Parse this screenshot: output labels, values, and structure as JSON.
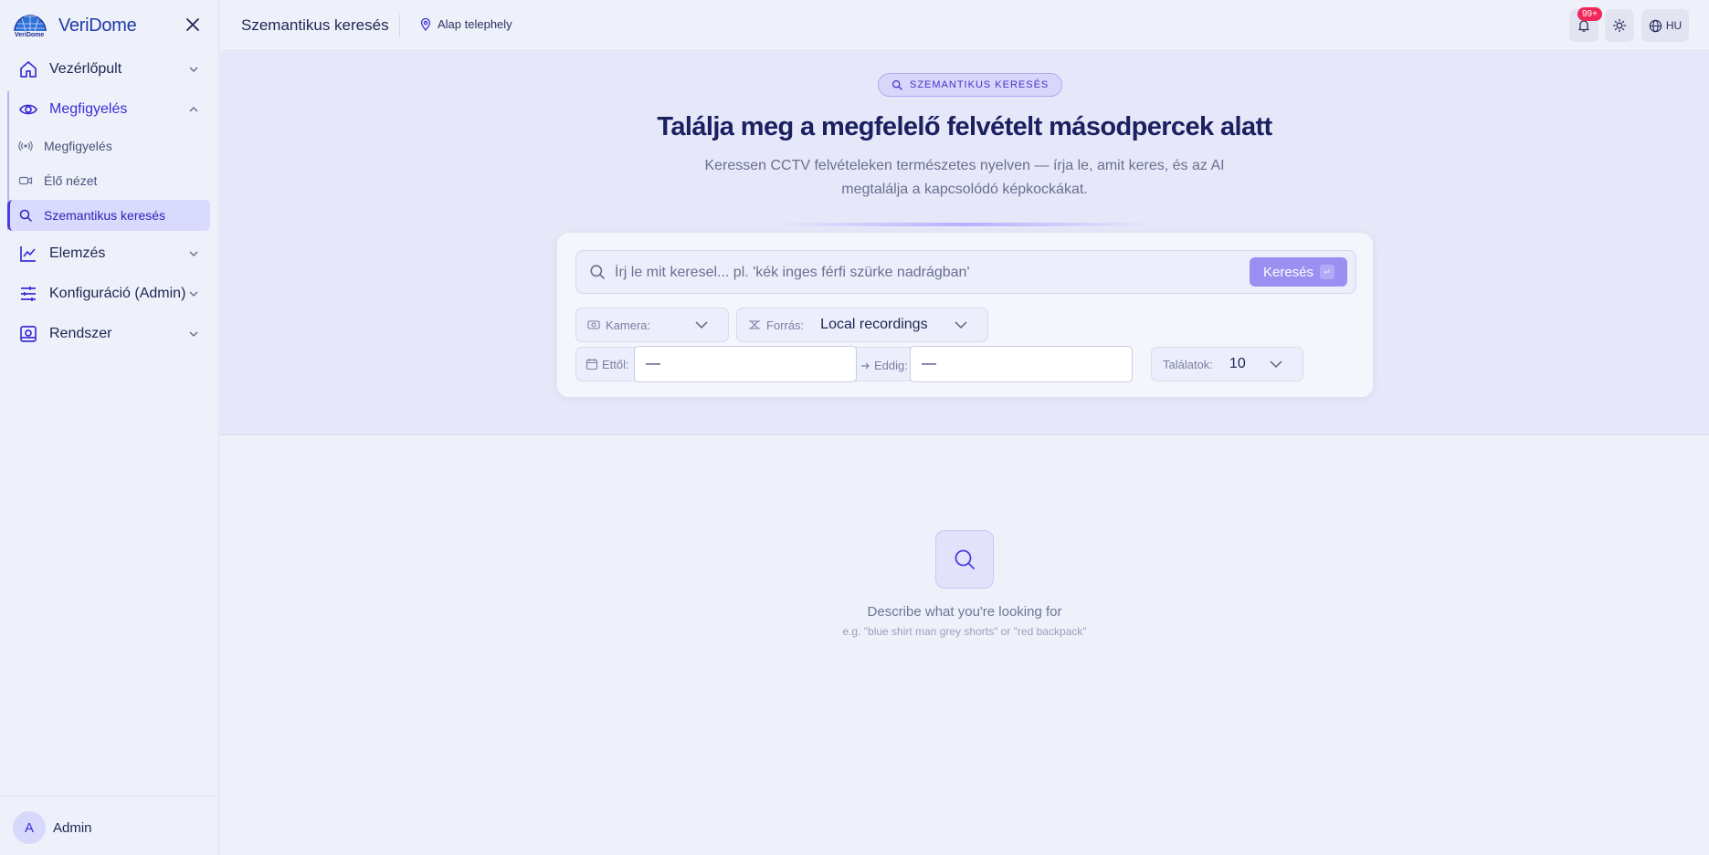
{
  "brand": {
    "name": "VeriDome",
    "logo_text": "VeriDome"
  },
  "sidebar": {
    "items": [
      {
        "label": "Vezérlőpult"
      },
      {
        "label": "Megfigyelés"
      },
      {
        "label": "Elemzés"
      },
      {
        "label": "Konfiguráció (Admin)"
      },
      {
        "label": "Rendszer"
      }
    ],
    "sub_items": [
      {
        "label": "Megfigyelés"
      },
      {
        "label": "Élő nézet"
      },
      {
        "label": "Szemantikus keresés"
      }
    ],
    "user": {
      "initial": "A",
      "name": "Admin"
    }
  },
  "header": {
    "title": "Szemantikus keresés",
    "site": "Alap telephely",
    "notifications_badge": "99+",
    "language": "HU"
  },
  "hero": {
    "pill": "SZEMANTIKUS KERESÉS",
    "title": "Találja meg a megfelelő felvételt másodpercek alatt",
    "subtitle": "Keressen CCTV felvételeken természetes nyelven — írja le, amit keres, és az AI megtalálja a kapcsolódó képkockákat."
  },
  "search": {
    "placeholder": "Írj le mit keresel... pl. 'kék inges férfi szürke nadrágban'",
    "value": "",
    "button_label": "Keresés",
    "kbd": "↵"
  },
  "filters": {
    "camera_label": "Kamera:",
    "camera_value": "",
    "source_label": "Forrás:",
    "source_value": "Local recordings",
    "from_label": "Ettől:",
    "from_value": "—",
    "to_label": "Eddig:",
    "to_value": "—",
    "limit_label": "Találatok:",
    "limit_value": "10"
  },
  "empty_state": {
    "title": "Describe what you're looking for",
    "hint": "e.g. \"blue shirt man grey shorts\" or \"red backpack\""
  },
  "colors": {
    "accent": "#4a3de0",
    "button": "#9b8ff2",
    "badge": "#f0285a",
    "background": "#eef1fa"
  }
}
